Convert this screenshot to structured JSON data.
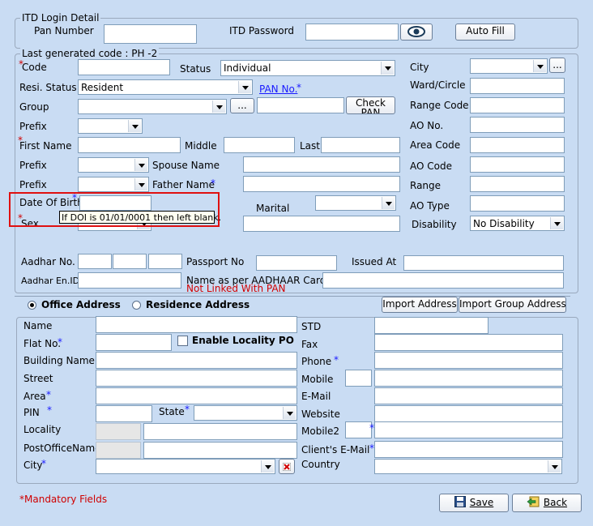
{
  "itd_login": {
    "legend": "ITD Login Detail",
    "pan_number_label": "Pan Number",
    "pan_number_value": "",
    "itd_password_label": "ITD Password",
    "itd_password_value": "",
    "auto_fill_label": "Auto Fill"
  },
  "main": {
    "legend": "Last generated code :   PH  -2",
    "code_label": "Code",
    "status_label": "Status",
    "status_value": "Individual",
    "city_label": "City",
    "resi_status_label": "Resi. Status",
    "resi_status_value": "Resident",
    "pan_no_label": "PAN No.",
    "ward_circle_label": "Ward/Circle",
    "group_label": "Group",
    "dots_label": "...",
    "check_pan_label": "Check PAN",
    "range_code_label": "Range Code",
    "prefix_label": "Prefix",
    "ao_no_label": "AO No.",
    "first_name_label": "First Name",
    "middle_label": "Middle",
    "last_label": "Last",
    "area_code_label": "Area Code",
    "spouse_name_label": "Spouse Name",
    "ao_code_label": "AO Code",
    "father_name_label": "Father Name",
    "range_label": "Range",
    "dob_label": "Date Of Birth",
    "marital_label": "Marital",
    "ao_type_label": "AO Type",
    "sex_label": "Sex",
    "dob_tooltip": "If DOI is 01/01/0001 then left blank.",
    "disability_label": "Disability",
    "disability_value": "No Disability",
    "aadhar_no_label": "Aadhar No.",
    "passport_no_label": "Passport No",
    "issued_at_label": "Issued At",
    "aadhar_en_id_label": "Aadhar En.ID",
    "name_as_aadhaar_label": "Name as per AADHAAR Card",
    "not_linked_text": "Not Linked With PAN",
    "mandatory_marker": "*"
  },
  "address": {
    "office_label": "Office Address",
    "residence_label": "Residence Address",
    "import_address_label": "Import Address",
    "import_group_address_label": "Import Group Address",
    "name_label": "Name",
    "std_label": "STD",
    "flat_no_label": "Flat No.",
    "enable_locality_label": "Enable Locality PO",
    "fax_label": "Fax",
    "building_name_label": "Building Name",
    "phone_label": "Phone",
    "street_label": "Street",
    "mobile_label": "Mobile",
    "area_label": "Area",
    "email_label": "E-Mail",
    "pin_label": "PIN",
    "state_label": "State",
    "website_label": "Website",
    "locality_label": "Locality",
    "mobile2_label": "Mobile2",
    "post_office_label": "PostOfficeName",
    "clients_email_label": "Client's E-Mail",
    "city_label": "City",
    "country_label": "Country"
  },
  "footer": {
    "mandatory_fields": "*Mandatory Fields",
    "save_label": "Save",
    "back_label": "Back"
  },
  "colors": {
    "background": "#c9dcf3",
    "mandatory_red": "#d00000",
    "highlight_red": "#e01010"
  }
}
